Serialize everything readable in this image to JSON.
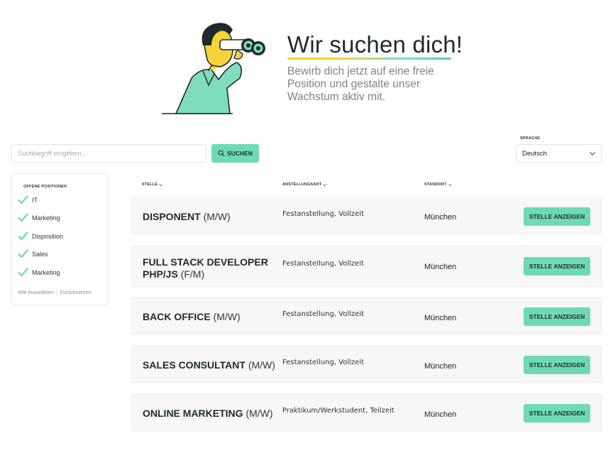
{
  "hero": {
    "title": "Wir suchen dich!",
    "subtitle": "Bewirb dich jetzt auf eine freie Position und gestalte unser Wachstum aktiv mit."
  },
  "search": {
    "placeholder": "Suchbegriff eingeben...",
    "button_label": "SUCHEN"
  },
  "language": {
    "label": "SPRACHE",
    "selected": "Deutsch"
  },
  "filters": {
    "title": "OFFENE POSITIONEN",
    "items": [
      {
        "label": "IT",
        "checked": true
      },
      {
        "label": "Marketing",
        "checked": true
      },
      {
        "label": "Disposition",
        "checked": true
      },
      {
        "label": "Sales",
        "checked": true
      },
      {
        "label": "Marketing",
        "checked": true
      }
    ],
    "select_all": "Alle Auswählen",
    "separator": "|",
    "reset": "Zurücksetzen"
  },
  "columns": {
    "position": "STELLE",
    "employment": "ANSTELLUNGSART",
    "location": "STANDORT"
  },
  "jobs": [
    {
      "title_line1": "DISPONENT",
      "suffix": "(M/W)",
      "title_line2": "",
      "employment": "Festanstellung, Vollzeit",
      "location": "München",
      "button": "STELLE ANZEIGEN"
    },
    {
      "title_line1": "FULL STACK DEVELOPER",
      "suffix": "(F/M)",
      "title_line2": "PHP/JS",
      "employment": "Festanstellung, Vollzeit",
      "location": "München",
      "button": "STELLE ANZEIGEN"
    },
    {
      "title_line1": "BACK OFFICE",
      "suffix": "(M/W)",
      "title_line2": "",
      "employment": "Festanstellung, Vollzeit",
      "location": "München",
      "button": "STELLE ANZEIGEN"
    },
    {
      "title_line1": "SALES CONSULTANT",
      "suffix": "(M/W)",
      "title_line2": "",
      "employment": "Festanstellung, Vollzeit",
      "location": "München",
      "button": "STELLE ANZEIGEN"
    },
    {
      "title_line1": "ONLINE MARKETING",
      "suffix": "(M/W)",
      "title_line2": "",
      "employment": "Praktikum/Werkstudent, Teilzeit",
      "location": "München",
      "button": "STELLE ANZEIGEN"
    }
  ],
  "colors": {
    "accent": "#6ed9b5",
    "title_text": "#1f2a2a",
    "illustration_shirt": "#7fdcbc",
    "illustration_skin": "#f6d33b",
    "illustration_hair": "#1f2a2a"
  },
  "icons": {
    "illustration": "person-with-binoculars-illustration",
    "search_button": "search-icon",
    "language_select": "chevron-down-icon",
    "sort": "chevron-down-icon",
    "filter_check": "check-icon"
  }
}
